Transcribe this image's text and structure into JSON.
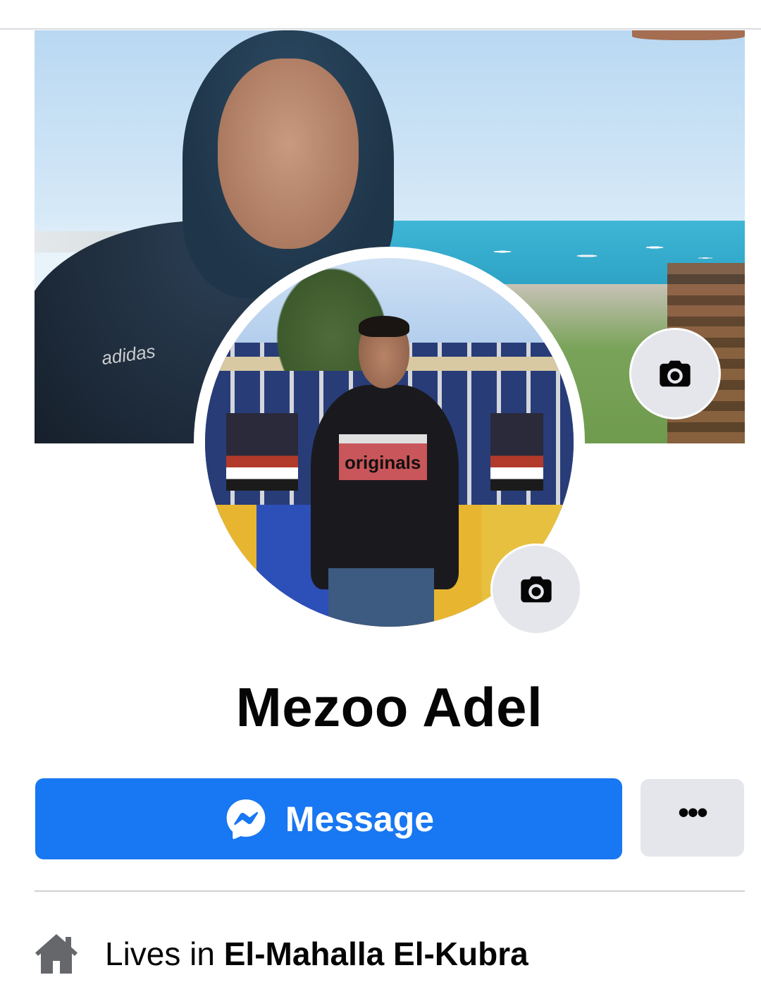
{
  "profile": {
    "name": "Mezoo Adel"
  },
  "actions": {
    "message_label": "Message",
    "more_label": "•••"
  },
  "about": {
    "lives_in_prefix": "Lives in ",
    "lives_in_place": "El-Mahalla El-Kubra"
  },
  "photos": {
    "cover_brand_text": "adidas",
    "avatar_shirt_text": "originals"
  },
  "icons": {
    "cover_camera": "camera-icon",
    "avatar_camera": "camera-icon",
    "messenger": "messenger-icon",
    "more": "more-dots-icon",
    "home": "home-icon"
  },
  "colors": {
    "primary_button": "#1877f2",
    "secondary_button": "#e4e6eb",
    "text": "#050505",
    "divider": "#ced0d4",
    "icon_gray": "#65676b"
  }
}
